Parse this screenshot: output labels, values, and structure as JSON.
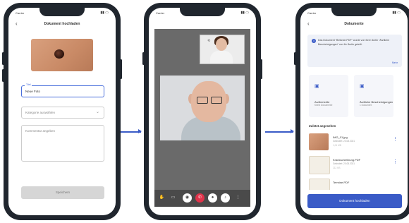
{
  "status": {
    "carrier": "Carrier",
    "time": "12:00"
  },
  "icons": {
    "back": "back-arrow-icon",
    "chevron": "chevron-down-icon",
    "info": "info-icon",
    "more": "more-vertical-icon",
    "folder": "folder-icon"
  },
  "colors": {
    "accent": "#3a5bc7",
    "hangup": "#e0334a"
  },
  "upload_screen": {
    "title": "Dokument hochladen",
    "name_label": "Titel",
    "name_value": "Neue Foto",
    "category_placeholder": "Kategorie auswählen",
    "comment_placeholder": "Kommentar angeben",
    "save_label": "Speichern"
  },
  "call_screen": {
    "controls": [
      "hand-icon",
      "chat-icon",
      "camera-icon",
      "hangup-icon",
      "mic-icon",
      "speaker-icon",
      "more-icon"
    ]
  },
  "documents_screen": {
    "title": "Dokumente",
    "info_text": "Das Dokument \"Befunde.PDF\" wurde von Ihrer Ärztin \"Ärztliche Bescheinigungen\" von Ihr Ärztin geteilt.",
    "info_link": "Mehr",
    "categories": [
      {
        "name": "Arztberichte",
        "sub": "Keine Dokumente"
      },
      {
        "name": "Ärztliche Bescheinigungen",
        "sub": "1 Dokument"
      }
    ],
    "recent_heading": "Zuletzt angesehen",
    "recent": [
      {
        "name": "IMG_01.jpg",
        "date": "Geändert: 20.08.2021",
        "size": "1,04 MB"
      },
      {
        "name": "Krankschreibung.PDF",
        "date": "Geändert: 20.08.2021",
        "size": "212 KB"
      },
      {
        "name": "Termine.PDF",
        "date": "",
        "size": ""
      }
    ],
    "upload_label": "Dokument hochladen"
  }
}
